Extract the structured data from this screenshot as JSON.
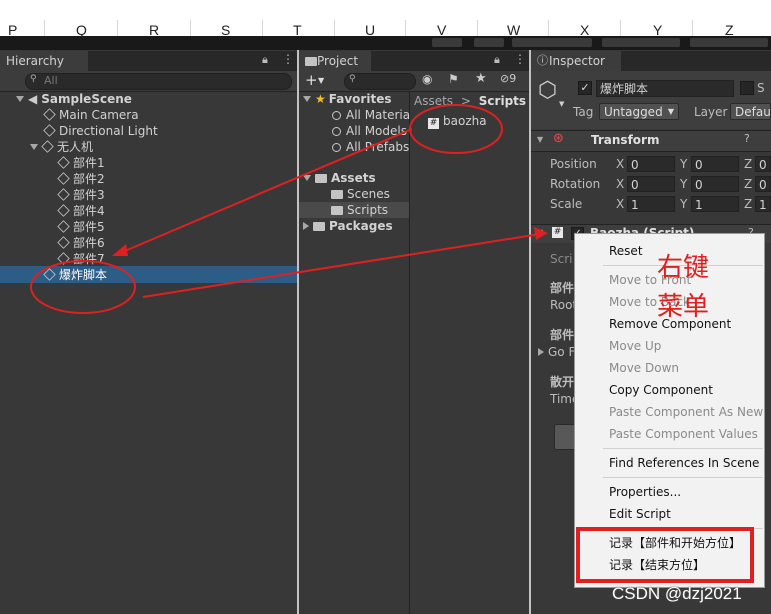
{
  "spreadsheet_columns": [
    "P",
    "Q",
    "R",
    "S",
    "T",
    "U",
    "V",
    "W",
    "X",
    "Y",
    "Z"
  ],
  "hierarchy": {
    "tab": "Hierarchy",
    "search_placeholder": "All",
    "scene": "SampleScene",
    "items": [
      "Main Camera",
      "Directional Light",
      "无人机",
      "部件1",
      "部件2",
      "部件3",
      "部件4",
      "部件5",
      "部件6",
      "部件7",
      "爆炸脚本"
    ]
  },
  "project": {
    "tab": "Project",
    "favorites_label": "Favorites",
    "favorites": [
      "All Materia",
      "All Models",
      "All Prefabs"
    ],
    "assets_label": "Assets",
    "assets_children": [
      "Scenes",
      "Scripts"
    ],
    "packages_label": "Packages",
    "breadcrumb_root": "Assets",
    "breadcrumb_sep": ">",
    "breadcrumb_leaf": "Scripts",
    "file": "baozha",
    "hidden_count": "9"
  },
  "inspector": {
    "tab": "Inspector",
    "object_name": "爆炸脚本",
    "static_initial": "S",
    "tag_label": "Tag",
    "tag_value": "Untagged",
    "layer_label": "Layer",
    "layer_value": "Defau",
    "transform_title": "Transform",
    "rows": [
      {
        "label": "Position",
        "x": "0",
        "y": "0",
        "z": "0"
      },
      {
        "label": "Rotation",
        "x": "0",
        "y": "0",
        "z": "0"
      },
      {
        "label": "Scale",
        "x": "1",
        "y": "1",
        "z": "1"
      }
    ],
    "script_component": "Baozha (Script)",
    "partial_labels": [
      "Scri",
      "部件",
      "Root",
      "部件",
      "Go F",
      "散开",
      "Time"
    ]
  },
  "context_menu": {
    "items": [
      {
        "label": "Reset",
        "enabled": true
      },
      {
        "label": "Move to Front",
        "enabled": false
      },
      {
        "label": "Move to Back",
        "enabled": false
      },
      {
        "label": "Remove Component",
        "enabled": true
      },
      {
        "label": "Move Up",
        "enabled": false
      },
      {
        "label": "Move Down",
        "enabled": false
      },
      {
        "label": "Copy Component",
        "enabled": true
      },
      {
        "label": "Paste Component As New",
        "enabled": false
      },
      {
        "label": "Paste Component Values",
        "enabled": false
      },
      {
        "label": "Find References In Scene",
        "enabled": true
      },
      {
        "label": "Properties...",
        "enabled": true
      },
      {
        "label": "Edit Script",
        "enabled": true
      },
      {
        "label": "记录【部件和开始方位】",
        "enabled": true
      },
      {
        "label": "记录【结束方位】",
        "enabled": true
      }
    ]
  },
  "annotations": {
    "right_click_line1": "右键",
    "right_click_line2": "菜单",
    "red_color": "#e02020"
  },
  "watermark": "CSDN @dzj2021"
}
